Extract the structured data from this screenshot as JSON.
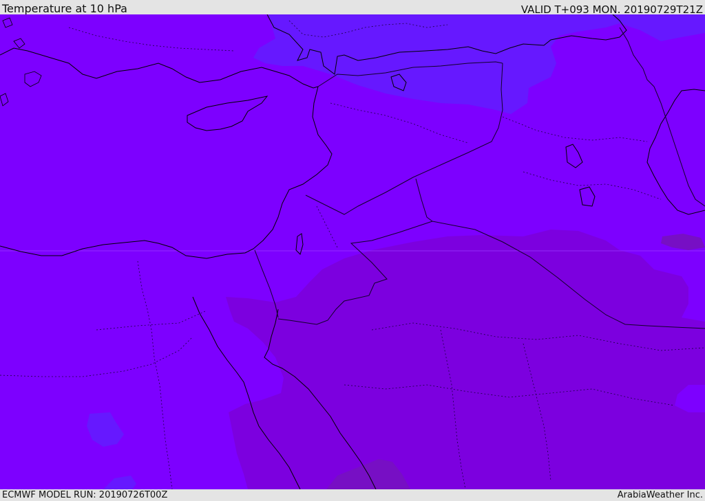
{
  "header": {
    "title": "Temperature at 10 hPa",
    "valid_time": "VALID T+093 MON. 20190729T21Z"
  },
  "footer": {
    "model_run": "ECMWF MODEL RUN: 20190726T00Z",
    "credit": "ArabiaWeather Inc."
  },
  "map": {
    "field": "temperature",
    "pressure_level": "10 hPa",
    "colors": {
      "base_violet": "#7d00ff",
      "cooler_blue_violet": "#6618ff",
      "warmer_purple": "#7c00df",
      "warmest_purple": "#770fc4",
      "coastline": "#000000",
      "border": "#1a0040"
    }
  }
}
